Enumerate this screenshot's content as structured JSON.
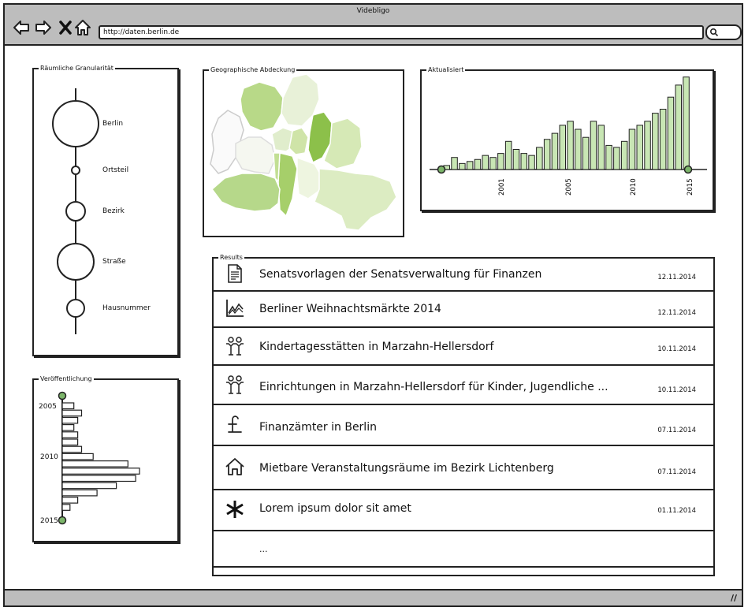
{
  "window": {
    "title": "Videbligo",
    "url": "http://daten.berlin.de"
  },
  "icons": {
    "back": "arrow-left-icon",
    "forward": "arrow-right-icon",
    "stop": "close-icon",
    "home": "home-icon",
    "search": "search-icon",
    "resize": "resize-grip-icon"
  },
  "granularity": {
    "label": "Räumliche Granularität",
    "levels": [
      "Berlin",
      "Ortsteil",
      "Bezirk",
      "Straße",
      "Hausnummer"
    ]
  },
  "coverage": {
    "label": "Geographische Abdeckung"
  },
  "updated": {
    "label": "Aktualisiert",
    "chart_data": {
      "type": "bar",
      "x_ticks": [
        "2001",
        "2005",
        "2010",
        "2015"
      ],
      "values": [
        2,
        6,
        3,
        4,
        5,
        7,
        6,
        8,
        14,
        10,
        8,
        7,
        11,
        15,
        18,
        22,
        24,
        20,
        16,
        24,
        22,
        12,
        11,
        14,
        20,
        22,
        24,
        28,
        30,
        36,
        42,
        46
      ],
      "color": "#c8e6b4"
    }
  },
  "publication": {
    "label": "Veröffentlichung",
    "years": [
      "2005",
      "2010",
      "2015"
    ],
    "chart_data": {
      "type": "bar",
      "orientation": "horizontal",
      "values": [
        3,
        5,
        4,
        3,
        4,
        4,
        5,
        8,
        17,
        20,
        19,
        14,
        9,
        4,
        2
      ],
      "color": "#ffffff"
    }
  },
  "results": {
    "label": "Results",
    "items": [
      {
        "icon": "document-icon",
        "title": "Senatsvorlagen der Senatsverwaltung für Finanzen",
        "date": "12.11.2014"
      },
      {
        "icon": "line-chart-icon",
        "title": "Berliner Weihnachtsmärkte 2014",
        "date": "12.11.2014"
      },
      {
        "icon": "children-icon",
        "title": "Kindertagesstätten in Marzahn-Hellersdorf",
        "date": "10.11.2014"
      },
      {
        "icon": "children-icon",
        "title": "Einrichtungen in Marzahn-Hellersdorf für Kinder, Jugendliche ...",
        "date": "10.11.2014"
      },
      {
        "icon": "pound-icon",
        "title": "Finanzämter in Berlin",
        "date": "07.11.2014"
      },
      {
        "icon": "house-icon",
        "title": "Mietbare Veranstaltungsräume im Bezirk Lichtenberg",
        "date": "07.11.2014"
      },
      {
        "icon": "asterisk-icon",
        "title": "Lorem ipsum dolor sit amet",
        "date": "01.11.2014"
      }
    ],
    "more": "..."
  }
}
